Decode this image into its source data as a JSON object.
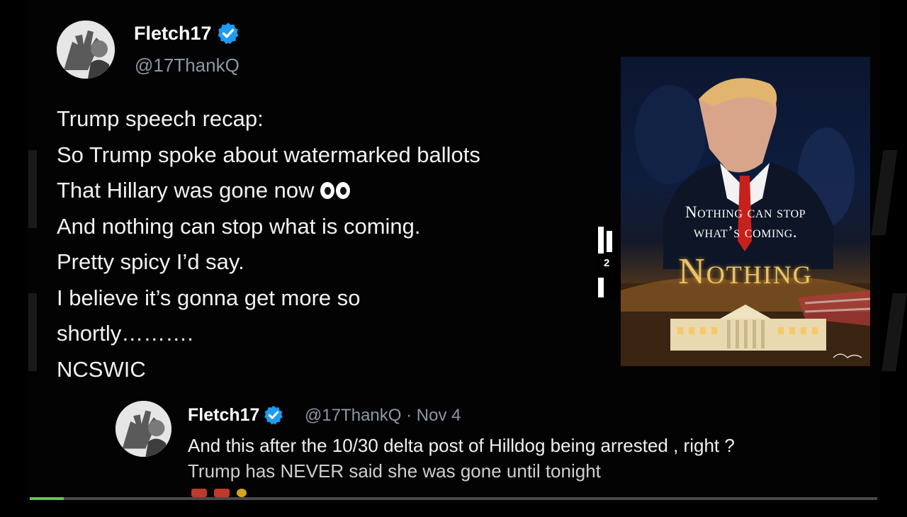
{
  "tweet": {
    "author_name": "Fletch17",
    "author_handle": "@17ThankQ",
    "verified_icon": "verified-badge-icon",
    "lines": [
      "Trump speech recap:",
      "So Trump spoke about watermarked ballots",
      "That Hillary was gone now",
      "And nothing can stop what is coming.",
      "Pretty spicy I’d say.",
      "I believe it’s gonna get more so",
      "shortly……….",
      "NCSWIC"
    ],
    "eyes_icon": "eyes-emoji-icon"
  },
  "poster": {
    "line1": "Nothing can stop",
    "line2": "what’s coming.",
    "big_text": "Nothing"
  },
  "side_mark": {
    "text": "2"
  },
  "reply": {
    "author_name": "Fletch17",
    "author_handle": "@17ThankQ",
    "separator": "·",
    "date": "Nov 4",
    "line1": "And this after the 10/30 delta post of Hilldog being arrested , right ?",
    "line2": "Trump has NEVER said she was gone until tonight"
  },
  "video": {
    "progress_fraction": 0.04
  },
  "colors": {
    "background": "#000000",
    "verified_blue": "#1d9bf0",
    "handle_gray": "#8b98a5",
    "progress_green": "#6cc04a",
    "poster_gold": "#e8c36a"
  }
}
